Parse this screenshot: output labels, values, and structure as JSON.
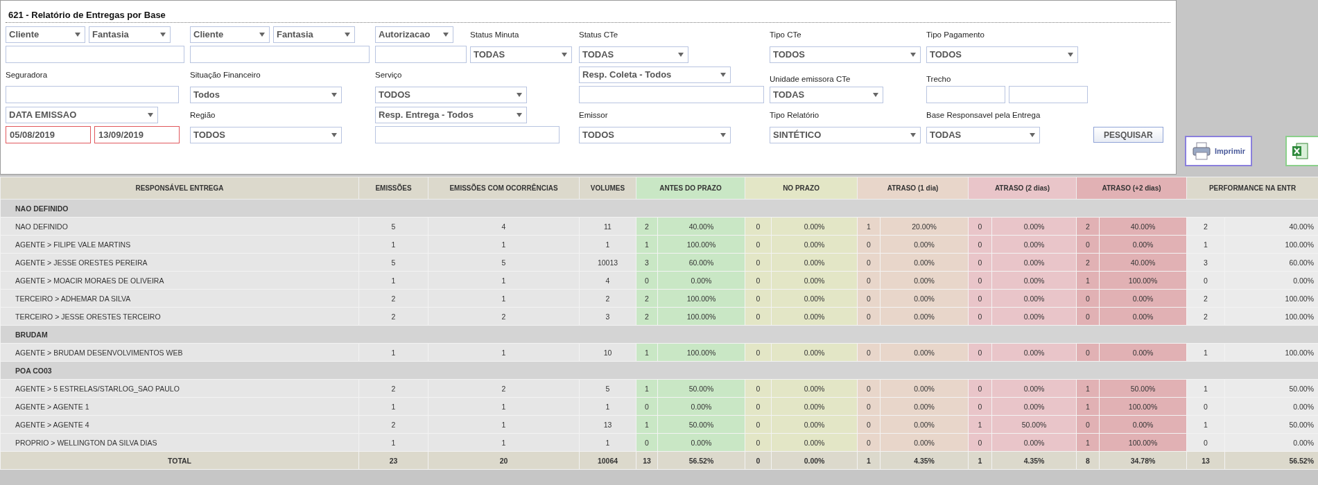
{
  "panel": {
    "title": "621 - Relatório de Entregas por Base",
    "filters": [
      {
        "kind": "pair",
        "fields": [
          {
            "kind": "select",
            "value": "Cliente"
          },
          {
            "kind": "select",
            "value": "Fantasia"
          }
        ]
      },
      {
        "kind": "pair",
        "fields": [
          {
            "kind": "select",
            "value": "Cliente"
          },
          {
            "kind": "select",
            "value": "Fantasia"
          }
        ]
      },
      {
        "kind": "select",
        "value": "Autorizacao"
      },
      {
        "kind": "label",
        "text": "Status Minuta"
      },
      {
        "kind": "label",
        "text": "Status CTe"
      },
      {
        "kind": "label",
        "text": "Tipo CTe"
      },
      {
        "kind": "label",
        "text": "Tipo Pagamento"
      },
      {
        "kind": "input"
      },
      {
        "kind": "input"
      },
      {
        "kind": "input"
      },
      {
        "kind": "select",
        "value": "TODAS"
      },
      {
        "kind": "select",
        "value": "TODAS"
      },
      {
        "kind": "select",
        "value": "TODOS"
      },
      {
        "kind": "select",
        "value": "TODOS"
      },
      {
        "kind": "label",
        "text": "Seguradora"
      },
      {
        "kind": "label",
        "text": "Situação Financeiro"
      },
      {
        "kind": "label",
        "text": "Serviço"
      },
      {
        "kind": "select",
        "value": "Resp. Coleta - Todos"
      },
      {
        "kind": "label",
        "text": "Unidade emissora CTe"
      },
      {
        "kind": "label",
        "text": "Trecho"
      },
      {
        "kind": "input"
      },
      {
        "kind": "select",
        "value": "Todos"
      },
      {
        "kind": "select",
        "value": "TODOS"
      },
      {
        "kind": "input"
      },
      {
        "kind": "select",
        "value": "TODAS"
      },
      {
        "kind": "pair",
        "fields": [
          {
            "kind": "input"
          },
          {
            "kind": "input"
          }
        ]
      },
      {
        "kind": "select",
        "value": "DATA EMISSAO"
      },
      {
        "kind": "label",
        "text": "Região"
      },
      {
        "kind": "select",
        "value": "Resp. Entrega - Todos"
      },
      {
        "kind": "label",
        "text": "Emissor"
      },
      {
        "kind": "label",
        "text": "Tipo Relatório"
      },
      {
        "kind": "label",
        "text": "Base Responsavel pela Entrega"
      },
      {
        "kind": "pair",
        "fields": [
          {
            "kind": "date",
            "value": "05/08/2019"
          },
          {
            "kind": "date",
            "value": "13/09/2019"
          }
        ]
      },
      {
        "kind": "select",
        "value": "TODOS"
      },
      {
        "kind": "input"
      },
      {
        "kind": "select",
        "value": "TODOS"
      },
      {
        "kind": "select",
        "value": "SINTÉTICO"
      },
      {
        "kind": "select",
        "value": "TODAS"
      },
      {
        "kind": "button",
        "label": "PESQUISAR"
      }
    ]
  },
  "actions": [
    {
      "kind": "print",
      "label": "Imprimir"
    },
    {
      "kind": "excel"
    }
  ],
  "table": {
    "columns": [
      "RESPONSÁVEL ENTREGA",
      "EMISSÕES",
      "EMISSÕES COM OCORRÊNCIAS",
      "VOLUMES",
      "ANTES DO PRAZO",
      "NO PRAZO",
      "ATRASO (1 dia)",
      "ATRASO (2 dias)",
      "ATRASO (+2 dias)",
      "PERFORMANCE NA ENTR"
    ],
    "rows": [
      {
        "kind": "group",
        "label": "NAO DEFINIDO"
      },
      {
        "kind": "row",
        "cells": [
          "NAO DEFINIDO",
          "5",
          "4",
          "11",
          "2",
          "40.00%",
          "0",
          "0.00%",
          "1",
          "20.00%",
          "0",
          "0.00%",
          "2",
          "40.00%",
          "2",
          "40.00%"
        ]
      },
      {
        "kind": "row",
        "cells": [
          "AGENTE > FILIPE VALE MARTINS",
          "1",
          "1",
          "1",
          "1",
          "100.00%",
          "0",
          "0.00%",
          "0",
          "0.00%",
          "0",
          "0.00%",
          "0",
          "0.00%",
          "1",
          "100.00%"
        ]
      },
      {
        "kind": "row",
        "cells": [
          "AGENTE > JESSE ORESTES PEREIRA",
          "5",
          "5",
          "10013",
          "3",
          "60.00%",
          "0",
          "0.00%",
          "0",
          "0.00%",
          "0",
          "0.00%",
          "2",
          "40.00%",
          "3",
          "60.00%"
        ]
      },
      {
        "kind": "row",
        "cells": [
          "AGENTE > MOACIR MORAES DE OLIVEIRA",
          "1",
          "1",
          "4",
          "0",
          "0.00%",
          "0",
          "0.00%",
          "0",
          "0.00%",
          "0",
          "0.00%",
          "1",
          "100.00%",
          "0",
          "0.00%"
        ]
      },
      {
        "kind": "row",
        "cells": [
          "TERCEIRO > ADHEMAR DA SILVA",
          "2",
          "1",
          "2",
          "2",
          "100.00%",
          "0",
          "0.00%",
          "0",
          "0.00%",
          "0",
          "0.00%",
          "0",
          "0.00%",
          "2",
          "100.00%"
        ]
      },
      {
        "kind": "row",
        "cells": [
          "TERCEIRO > JESSE ORESTES TERCEIRO",
          "2",
          "2",
          "3",
          "2",
          "100.00%",
          "0",
          "0.00%",
          "0",
          "0.00%",
          "0",
          "0.00%",
          "0",
          "0.00%",
          "2",
          "100.00%"
        ]
      },
      {
        "kind": "group",
        "label": "BRUDAM"
      },
      {
        "kind": "row",
        "cells": [
          "AGENTE > BRUDAM DESENVOLVIMENTOS WEB",
          "1",
          "1",
          "10",
          "1",
          "100.00%",
          "0",
          "0.00%",
          "0",
          "0.00%",
          "0",
          "0.00%",
          "0",
          "0.00%",
          "1",
          "100.00%"
        ]
      },
      {
        "kind": "group",
        "label": "POA CO03"
      },
      {
        "kind": "row",
        "cells": [
          "AGENTE > 5 ESTRELAS/STARLOG_SAO PAULO",
          "2",
          "2",
          "5",
          "1",
          "50.00%",
          "0",
          "0.00%",
          "0",
          "0.00%",
          "0",
          "0.00%",
          "1",
          "50.00%",
          "1",
          "50.00%"
        ]
      },
      {
        "kind": "row",
        "cells": [
          "AGENTE > AGENTE 1",
          "1",
          "1",
          "1",
          "0",
          "0.00%",
          "0",
          "0.00%",
          "0",
          "0.00%",
          "0",
          "0.00%",
          "1",
          "100.00%",
          "0",
          "0.00%"
        ]
      },
      {
        "kind": "row",
        "cells": [
          "AGENTE > AGENTE 4",
          "2",
          "1",
          "13",
          "1",
          "50.00%",
          "0",
          "0.00%",
          "0",
          "0.00%",
          "1",
          "50.00%",
          "0",
          "0.00%",
          "1",
          "50.00%"
        ]
      },
      {
        "kind": "row",
        "cells": [
          "PROPRIO > WELLINGTON DA SILVA DIAS",
          "1",
          "1",
          "1",
          "0",
          "0.00%",
          "0",
          "0.00%",
          "0",
          "0.00%",
          "0",
          "0.00%",
          "1",
          "100.00%",
          "0",
          "0.00%"
        ]
      },
      {
        "kind": "total",
        "cells": [
          "TOTAL",
          "23",
          "20",
          "10064",
          "13",
          "56.52%",
          "0",
          "0.00%",
          "1",
          "4.35%",
          "1",
          "4.35%",
          "8",
          "34.78%",
          "13",
          "56.52%"
        ]
      }
    ]
  }
}
